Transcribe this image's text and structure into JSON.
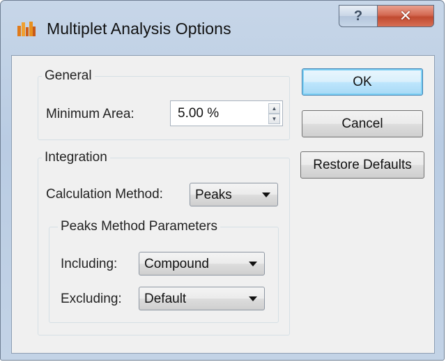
{
  "window": {
    "title": "Multiplet Analysis Options",
    "app_icon": "multiplet-app-icon",
    "help_glyph": "?",
    "close_glyph": "✕"
  },
  "general": {
    "group_label": "General",
    "min_area_label": "Minimum Area:",
    "min_area_value": "5.00 %"
  },
  "integration": {
    "group_label": "Integration",
    "calc_method_label": "Calculation Method:",
    "calc_method_value": "Peaks",
    "peaks_group_label": "Peaks Method Parameters",
    "including_label": "Including:",
    "including_value": "Compound",
    "excluding_label": "Excluding:",
    "excluding_value": "Default"
  },
  "buttons": {
    "ok": "OK",
    "cancel": "Cancel",
    "restore": "Restore Defaults"
  },
  "colors": {
    "accent": "#3c7fb1",
    "close_red": "#c04a30",
    "icon_orange": "#e07a1a"
  }
}
